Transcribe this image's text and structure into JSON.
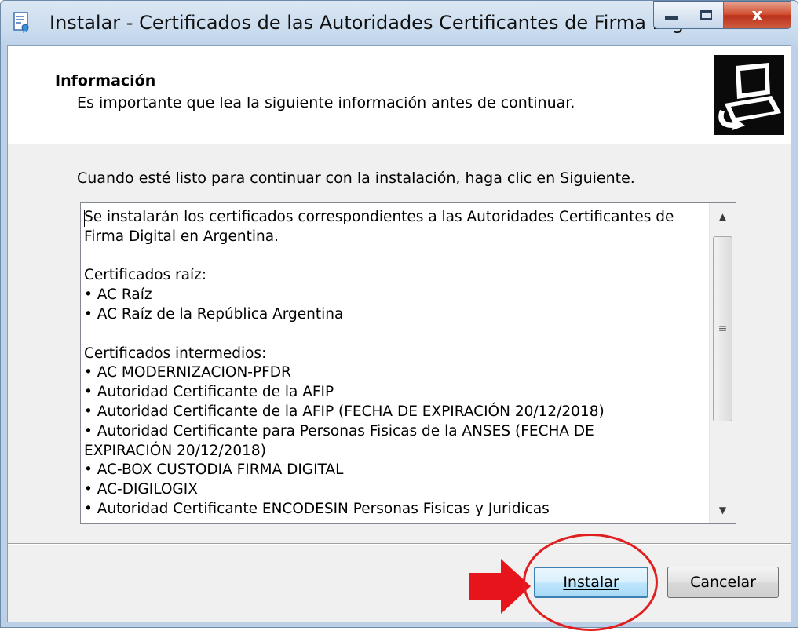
{
  "window": {
    "title": "Instalar - Certificados de las Autoridades Certificantes de Firma Digit...",
    "close_glyph": "x"
  },
  "header": {
    "title": "Información",
    "subtitle": "Es importante que lea la siguiente información antes de continuar."
  },
  "instruction": "Cuando esté listo para continuar con la instalación, haga clic en Siguiente.",
  "memo": {
    "lines": [
      "Se instalarán los certificados correspondientes a las Autoridades Certificantes de",
      "Firma Digital en Argentina.",
      "",
      "Certificados raíz:",
      "• AC Raíz",
      "• AC Raíz de la República Argentina",
      "",
      "Certificados intermedios:",
      "• AC MODERNIZACION-PFDR",
      "• Autoridad Certificante de la AFIP",
      "• Autoridad Certificante de la AFIP (FECHA DE EXPIRACIÓN 20/12/2018)",
      "• Autoridad Certificante para Personas Fisicas de la ANSES (FECHA DE",
      "EXPIRACIÓN 20/12/2018)",
      "• AC-BOX CUSTODIA FIRMA DIGITAL",
      "• AC-DIGILOGIX",
      "• Autoridad Certificante ENCODESIN Personas Fisicas y Juridicas"
    ]
  },
  "buttons": {
    "install": "Instalar",
    "cancel": "Cancelar"
  },
  "colors": {
    "annotation_red": "#e02020",
    "default_button_border": "#3c7fb1"
  }
}
